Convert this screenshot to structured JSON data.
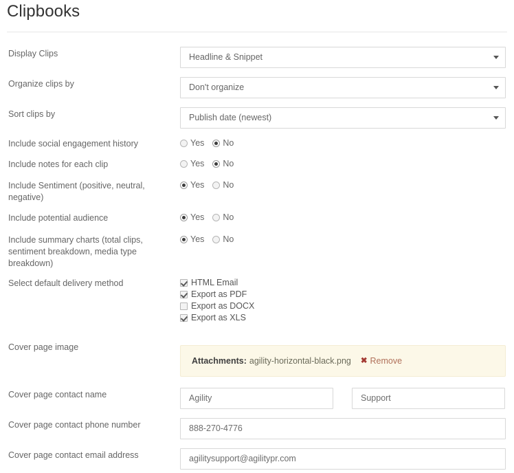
{
  "page": {
    "title": "Clipbooks"
  },
  "rows": {
    "display_clips": {
      "label": "Display Clips",
      "value": "Headline & Snippet"
    },
    "organize_clips_by": {
      "label": "Organize clips by",
      "value": "Don't organize"
    },
    "sort_clips_by": {
      "label": "Sort clips by",
      "value": "Publish date (newest)"
    },
    "social_engagement": {
      "label": "Include social engagement history",
      "yes_label": "Yes",
      "no_label": "No",
      "selected": "No"
    },
    "notes_each_clip": {
      "label": "Include notes for each clip",
      "yes_label": "Yes",
      "no_label": "No",
      "selected": "No"
    },
    "sentiment": {
      "label": "Include Sentiment (positive, neutral, negative)",
      "yes_label": "Yes",
      "no_label": "No",
      "selected": "Yes"
    },
    "potential_audience": {
      "label": "Include potential audience",
      "yes_label": "Yes",
      "no_label": "No",
      "selected": "Yes"
    },
    "summary_charts": {
      "label": "Include summary charts (total clips, sentiment breakdown, media type breakdown)",
      "yes_label": "Yes",
      "no_label": "No",
      "selected": "Yes"
    },
    "delivery_method": {
      "label": "Select default delivery method",
      "options": [
        {
          "label": "HTML Email",
          "checked": true
        },
        {
          "label": "Export as PDF",
          "checked": true
        },
        {
          "label": "Export as DOCX",
          "checked": false
        },
        {
          "label": "Export as XLS",
          "checked": true
        }
      ]
    },
    "cover_page_image": {
      "label": "Cover page image",
      "attachments_label": "Attachments:",
      "file_name": "agility-horizontal-black.png",
      "remove_icon": "close-x-icon",
      "remove_label": "Remove"
    },
    "contact_name": {
      "label": "Cover page contact name",
      "first_value": "Agility",
      "last_value": "Support"
    },
    "contact_phone": {
      "label": "Cover page contact phone number",
      "value": "888-270-4776"
    },
    "contact_email": {
      "label": "Cover page contact email address",
      "value": "agilitysupport@agilitypr.com"
    }
  },
  "icons": {
    "dropdown_caret": "chevron-down-icon"
  },
  "colors": {
    "banner_background": "#fcf8e8",
    "banner_border": "#f4edd4",
    "remove_icon": "#a33a33",
    "remove_text": "#b0705a",
    "label_text": "#666666",
    "title_text": "#333333",
    "input_border": "#d8d8d8"
  }
}
